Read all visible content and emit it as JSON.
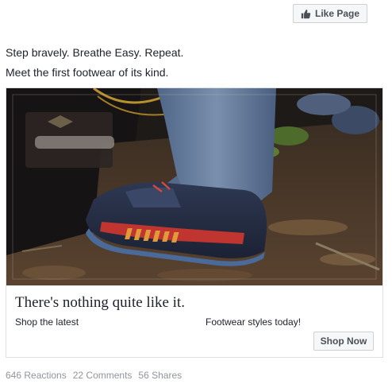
{
  "header": {
    "like_page_label": "Like Page",
    "like_icon": "thumbs-up-icon"
  },
  "post": {
    "text_line_1": "Step bravely. Breathe Easy. Repeat.",
    "text_line_2": "Meet the first footwear of its kind."
  },
  "ad": {
    "image_subject": "trail-shoe-photo",
    "headline": "There's nothing quite like it.",
    "description_left": "Shop the latest",
    "description_right": "Footwear styles today!",
    "cta_label": "Shop Now"
  },
  "engagement": {
    "reactions": "646 Reactions",
    "comments": "22 Comments",
    "shares": "56 Shares"
  },
  "colors": {
    "text_primary": "#1d2129",
    "text_secondary": "#90949c",
    "button_bg": "#f6f7f9",
    "border": "#dddfe2"
  }
}
